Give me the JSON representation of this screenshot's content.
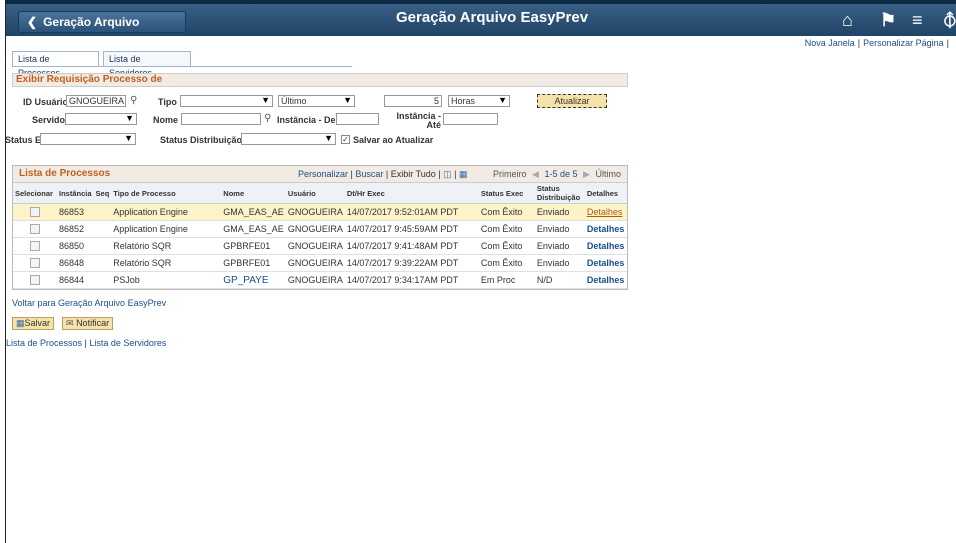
{
  "header": {
    "back_label": "Geração Arquivo EasyPrev",
    "title": "Geração Arquivo EasyPrev",
    "icons": [
      "home-icon",
      "flag-icon",
      "menu-icon",
      "navbar-icon"
    ]
  },
  "top_links": {
    "new_window": "Nova Janela",
    "personalize_page": "Personalizar Página"
  },
  "tabs": {
    "processes": "Lista de Processos",
    "servers": "Lista de Servidores"
  },
  "criteria": {
    "title": "Exibir Requisição Processo de",
    "user_id_label": "ID Usuário",
    "user_id_value": "GNOGUEIRA",
    "type_label": "Tipo",
    "type_value": "",
    "period_value": "Último",
    "count_value": "5",
    "unit_value": "Horas",
    "refresh_label": "Atualizar",
    "server_label": "Servidor",
    "server_value": "",
    "name_label": "Nome",
    "name_value": "",
    "instance_from_label": "Instância - De",
    "instance_to_label": "Instância - Até",
    "status_exec_label": "Status Exec",
    "status_exec_value": "",
    "status_dist_label": "Status Distribuição",
    "status_dist_value": "",
    "save_on_refresh_label": "Salvar ao Atualizar"
  },
  "grid": {
    "title": "Lista de Processos",
    "links": {
      "personalize": "Personalizar",
      "sep1": " | ",
      "find": "Buscar",
      "sep2": " | ",
      "view_all": "Exibir Tudo",
      "sep3": " | "
    },
    "nav": {
      "first": "Primeiro",
      "range": "1-5 de 5",
      "last": "Último"
    },
    "columns": [
      "Selecionar",
      "Instância",
      "Seq",
      "Tipo de Processo",
      "Nome",
      "Usuário",
      "Dt/Hr Exec",
      "Status Exec",
      "Status Distribuição",
      "Detalhes"
    ],
    "rows": [
      {
        "instance": "86853",
        "seq": "",
        "type": "Application Engine",
        "name": "GMA_EAS_AE",
        "user": "GNOGUEIRA",
        "datetime": "14/07/2017  9:52:01AM PDT",
        "status": "Com Êxito",
        "dist": "Enviado",
        "details": "Detalhes"
      },
      {
        "instance": "86852",
        "seq": "",
        "type": "Application Engine",
        "name": "GMA_EAS_AE",
        "user": "GNOGUEIRA",
        "datetime": "14/07/2017  9:45:59AM PDT",
        "status": "Com Êxito",
        "dist": "Enviado",
        "details": "Detalhes"
      },
      {
        "instance": "86850",
        "seq": "",
        "type": "Relatório SQR",
        "name": "GPBRFE01",
        "user": "GNOGUEIRA",
        "datetime": "14/07/2017  9:41:48AM PDT",
        "status": "Com Êxito",
        "dist": "Enviado",
        "details": "Detalhes"
      },
      {
        "instance": "86848",
        "seq": "",
        "type": "Relatório SQR",
        "name": "GPBRFE01",
        "user": "GNOGUEIRA",
        "datetime": "14/07/2017  9:39:22AM PDT",
        "status": "Com Êxito",
        "dist": "Enviado",
        "details": "Detalhes"
      },
      {
        "instance": "86844",
        "seq": "",
        "type": "PSJob",
        "name": "GP_PAYE",
        "user": "GNOGUEIRA",
        "datetime": "14/07/2017  9:34:17AM PDT",
        "status": "Em Proc",
        "dist": "N/D",
        "details": "Detalhes"
      }
    ]
  },
  "footer": {
    "back_link": "Voltar para Geração Arquivo EasyPrev",
    "save_label": "Salvar",
    "notify_label": "Notificar",
    "link_processes": "Lista de Processos",
    "link_sep": " | ",
    "link_servers": "Lista de Servidores"
  }
}
